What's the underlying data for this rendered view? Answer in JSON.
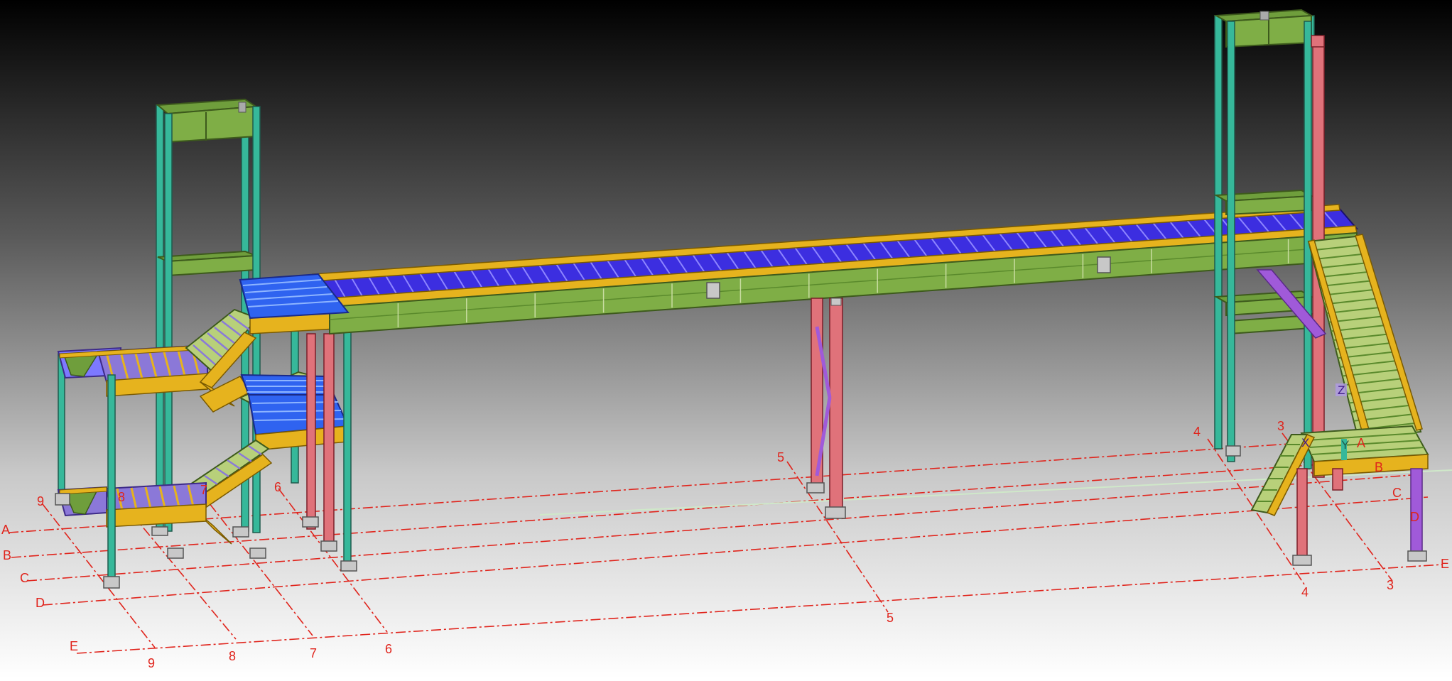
{
  "view": {
    "background_top": "#000000",
    "background_bottom": "#ffffff",
    "colors": {
      "column_cyan": "#36b89a",
      "column_red": "#e0727a",
      "beam_green": "#6f9e3c",
      "beam_green_dark": "#3d5a1c",
      "stringer_yellow": "#e6b31e",
      "grating_blue": "#3c2ee0",
      "grating_stripe": "#8d85ff",
      "deck_blue": "#2f63f0",
      "brace_purple": "#a05ad9",
      "gridline_red": "#e0241c"
    }
  },
  "grid_labels": {
    "letters": [
      "A",
      "B",
      "C",
      "D",
      "E"
    ],
    "numbers": [
      "9",
      "8",
      "7",
      "6",
      "5",
      "4",
      "3"
    ]
  },
  "axis_triad": {
    "x": "X",
    "y": "Y",
    "z": "Z"
  }
}
